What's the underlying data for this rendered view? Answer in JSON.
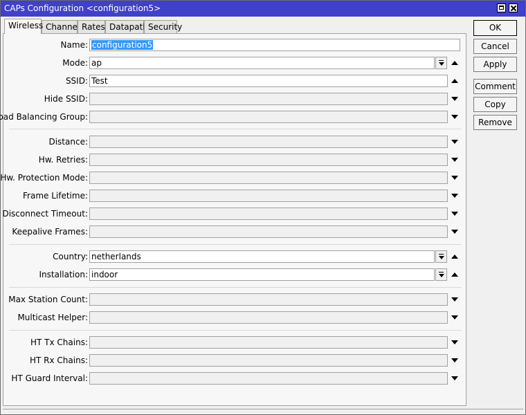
{
  "window": {
    "title": "CAPs Configuration <configuration5>",
    "accent_color": "#4040c8",
    "selection_color": "#3399ff"
  },
  "tabs": [
    {
      "label": "Wireless",
      "active": true
    },
    {
      "label": "Channel"
    },
    {
      "label": "Rates"
    },
    {
      "label": "Datapath"
    },
    {
      "label": "Security"
    }
  ],
  "form": {
    "name": {
      "label": "Name:",
      "value": "configuration5"
    },
    "mode": {
      "label": "Mode:",
      "value": "ap"
    },
    "ssid": {
      "label": "SSID:",
      "value": "Test"
    },
    "hide_ssid": {
      "label": "Hide SSID:",
      "value": ""
    },
    "load_balancing_group": {
      "label": "Load Balancing Group:",
      "value": ""
    },
    "distance": {
      "label": "Distance:",
      "value": ""
    },
    "hw_retries": {
      "label": "Hw. Retries:",
      "value": ""
    },
    "hw_protection_mode": {
      "label": "Hw. Protection Mode:",
      "value": ""
    },
    "frame_lifetime": {
      "label": "Frame Lifetime:",
      "value": ""
    },
    "disconnect_timeout": {
      "label": "Disconnect Timeout:",
      "value": ""
    },
    "keepalive_frames": {
      "label": "Keepalive Frames:",
      "value": ""
    },
    "country": {
      "label": "Country:",
      "value": "netherlands"
    },
    "installation": {
      "label": "Installation:",
      "value": "indoor"
    },
    "max_station_count": {
      "label": "Max Station Count:",
      "value": ""
    },
    "multicast_helper": {
      "label": "Multicast Helper:",
      "value": ""
    },
    "ht_tx_chains": {
      "label": "HT Tx Chains:",
      "value": ""
    },
    "ht_rx_chains": {
      "label": "HT Rx Chains:",
      "value": ""
    },
    "ht_guard_interval": {
      "label": "HT Guard Interval:",
      "value": ""
    }
  },
  "buttons": {
    "ok": "OK",
    "cancel": "Cancel",
    "apply": "Apply",
    "comment": "Comment",
    "copy": "Copy",
    "remove": "Remove"
  }
}
